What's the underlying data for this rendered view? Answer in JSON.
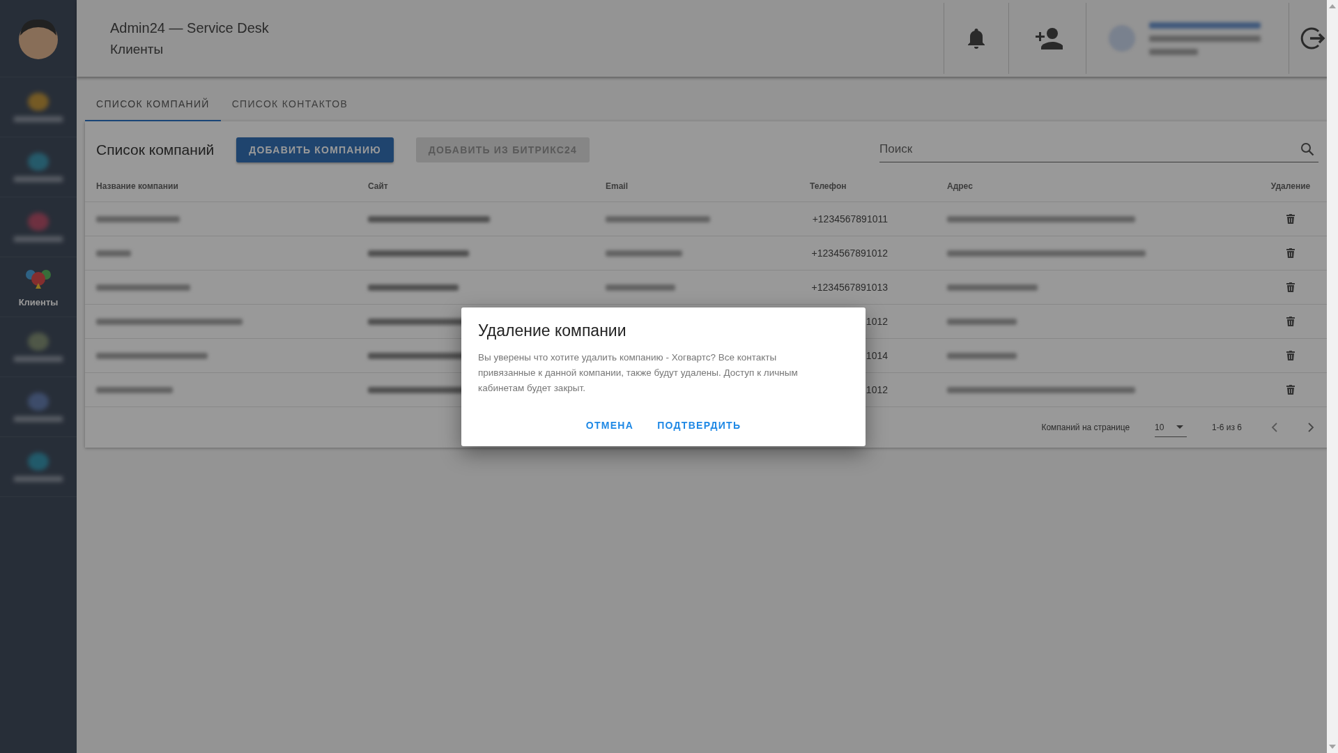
{
  "app": {
    "title": "Admin24 — Service Desk",
    "section": "Клиенты"
  },
  "sidebar": {
    "items": [
      {
        "selected": false
      },
      {
        "selected": false
      },
      {
        "selected": false
      },
      {
        "label": "Клиенты",
        "selected": true
      },
      {
        "selected": false
      },
      {
        "selected": false
      },
      {
        "selected": false
      }
    ]
  },
  "tabs": [
    {
      "label": "СПИСОК КОМПАНИЙ",
      "selected": true
    },
    {
      "label": "СПИСОК КОНТАКТОВ",
      "selected": false
    }
  ],
  "card": {
    "title": "Список компаний",
    "buttons": [
      {
        "label": "ДОБАВИТЬ КОМПАНИЮ",
        "disabled": false
      },
      {
        "label": "ДОБАВИТЬ ИЗ БИТРИКС24",
        "disabled": true
      }
    ],
    "search": {
      "placeholder": "Поиск"
    }
  },
  "table": {
    "columns": [
      "Название компании",
      "Сайт",
      "Email",
      "Телефон",
      "Адрес",
      "Удаление"
    ],
    "rows": [
      {
        "phone": "+1234567891011"
      },
      {
        "phone": "+1234567891012"
      },
      {
        "phone": "+1234567891013"
      },
      {
        "phone": "1012"
      },
      {
        "phone": "1014"
      },
      {
        "phone": "1012"
      }
    ]
  },
  "pagination": {
    "label": "Компаний на странице",
    "per_page": "10",
    "range": "1-6 из 6"
  },
  "dialog": {
    "title": "Удаление компании",
    "text": "Вы уверены что хотите удалить компанию - Хогвартс? Все контакты привязанные к данной компании, также будут удалены. Доступ к личным кабинетам будет закрыт.",
    "buttons": [
      "ОТМЕНА",
      "ПОДТВЕРДИТЬ"
    ]
  }
}
